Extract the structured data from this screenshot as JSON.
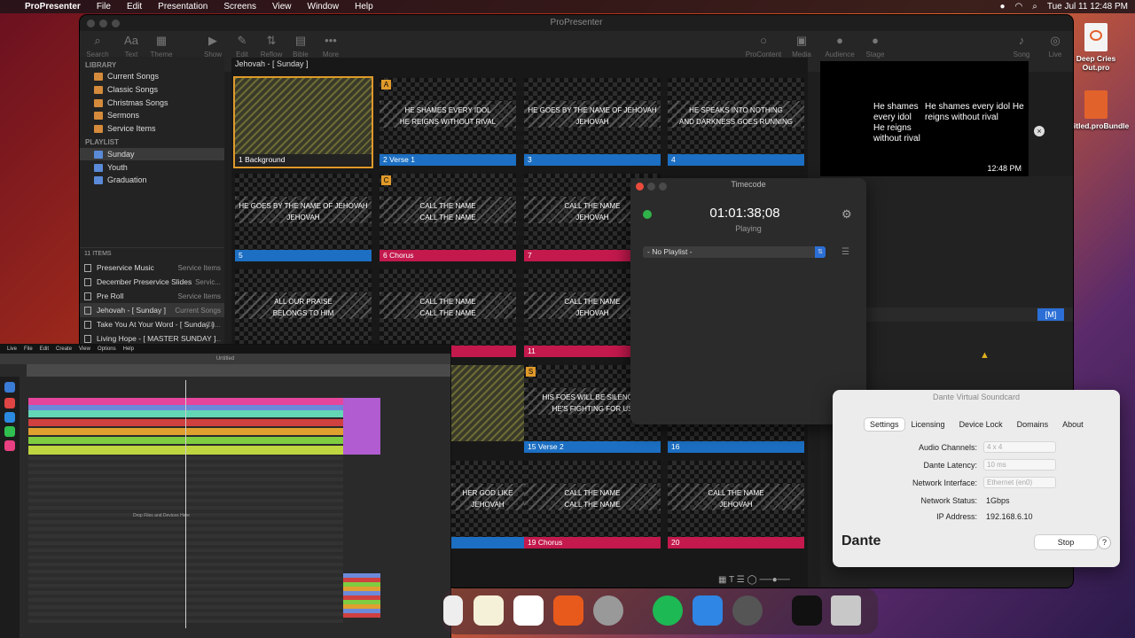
{
  "menubar": {
    "app": "ProPresenter",
    "items": [
      "File",
      "Edit",
      "Presentation",
      "Screens",
      "View",
      "Window",
      "Help"
    ],
    "clock": "Tue Jul 11  12:48 PM"
  },
  "propresenter": {
    "title": "ProPresenter",
    "toolbar": {
      "search": "Search",
      "text": "Text",
      "theme": "Theme",
      "show": "Show",
      "edit": "Edit",
      "reflow": "Reflow",
      "bible": "Bible",
      "more": "More",
      "procontent": "ProContent",
      "media": "Media",
      "audience": "Audience",
      "stage": "Stage",
      "song": "Song",
      "live": "Live"
    },
    "library": {
      "header": "LIBRARY",
      "folders": [
        "Current Songs",
        "Classic Songs",
        "Christmas Songs",
        "Sermons",
        "Service Items"
      ],
      "playlist_header": "PLAYLIST",
      "playlists": [
        "Sunday",
        "Youth",
        "Graduation"
      ],
      "items_count": "11 ITEMS",
      "items": [
        {
          "name": "Preservice Music",
          "cat": "Service Items"
        },
        {
          "name": "December Preservice Slides",
          "cat": "Servic..."
        },
        {
          "name": "Pre Roll",
          "cat": "Service Items"
        },
        {
          "name": "Jehovah - [ Sunday ]",
          "cat": "Current Songs"
        },
        {
          "name": "Take You At Your Word - [ Sunday ]",
          "cat": "Cu..."
        },
        {
          "name": "Living Hope - [ MASTER SUNDAY ]",
          "cat": "..."
        }
      ]
    },
    "presentation_title": "Jehovah - [ Sunday ]",
    "slides": [
      {
        "num": "1",
        "label": "Background",
        "text": "",
        "group": ""
      },
      {
        "num": "2",
        "label": "Verse 1",
        "text": "HE SHAMES EVERY IDOL\nHE REIGNS WITHOUT RIVAL",
        "group": "A"
      },
      {
        "num": "3",
        "label": "",
        "text": "HE GOES BY THE NAME OF JEHOVAH\nJEHOVAH",
        "group": ""
      },
      {
        "num": "4",
        "label": "",
        "text": "HE SPEAKS INTO NOTHING\nAND DARKNESS GOES RUNNING",
        "group": ""
      },
      {
        "num": "5",
        "label": "",
        "text": "HE GOES BY THE NAME OF JEHOVAH\nJEHOVAH",
        "group": ""
      },
      {
        "num": "6",
        "label": "Chorus",
        "text": "CALL THE NAME\nCALL THE NAME",
        "group": "C"
      },
      {
        "num": "7",
        "label": "",
        "text": "CALL THE NAME\nJEHOVAH",
        "group": ""
      },
      {
        "num": "",
        "label": "",
        "text": "ALL OUR PRAISE\nBELONGS TO HIM",
        "group": ""
      },
      {
        "num": "",
        "label": "",
        "text": "CALL THE NAME\nCALL THE NAME",
        "group": ""
      },
      {
        "num": "11",
        "label": "",
        "text": "CALL THE NAME\nJEHOVAH",
        "group": ""
      },
      {
        "num": "15",
        "label": "Verse 2",
        "text": "HIS FOES WILL BE SILENCED\nHE'S FIGHTING FOR US",
        "group": "S"
      },
      {
        "num": "16",
        "label": "",
        "text": "",
        "group": ""
      },
      {
        "num": "",
        "label": "",
        "text": "HER GOD LIKE\nJEHOVAH",
        "group": ""
      },
      {
        "num": "19",
        "label": "Chorus",
        "text": "CALL THE NAME\nCALL THE NAME",
        "group": ""
      },
      {
        "num": "20",
        "label": "",
        "text": "CALL THE NAME\nJEHOVAH",
        "group": ""
      }
    ],
    "preview": {
      "lyric_a": "He shames every idol He reigns without rival",
      "lyric_b": "He shames every idol He reigns without rival",
      "time": "12:48 PM"
    }
  },
  "timecode": {
    "title": "Timecode",
    "time": "01:01:38;08",
    "status": "Playing",
    "playlist": "- No Playlist -"
  },
  "dante": {
    "title": "Dante Virtual Soundcard",
    "tabs": [
      "Settings",
      "Licensing",
      "Device Lock",
      "Domains",
      "About"
    ],
    "audio_channels_label": "Audio Channels:",
    "audio_channels": "4 x 4",
    "latency_label": "Dante Latency:",
    "latency": "10 ms",
    "interface_label": "Network Interface:",
    "interface": "Ethernet (en0)",
    "status_label": "Network Status:",
    "status": "1Gbps",
    "ip_label": "IP Address:",
    "ip": "192.168.6.10",
    "logo": "Dante",
    "stop": "Stop",
    "help": "?"
  },
  "live": {
    "title": "Untitled",
    "menu": [
      "Live",
      "File",
      "Edit",
      "Create",
      "View",
      "Options",
      "Help"
    ],
    "drop": "Drop Files and Devices Here"
  },
  "desktop": {
    "file1": "Deep Cries Out.pro",
    "file2": "...titled.proBundle"
  },
  "colors": {
    "verse": "#1c6fc2",
    "chorus": "#c3194d",
    "group_badge": "#e09a2a",
    "playing_dot": "#2fb24a"
  }
}
